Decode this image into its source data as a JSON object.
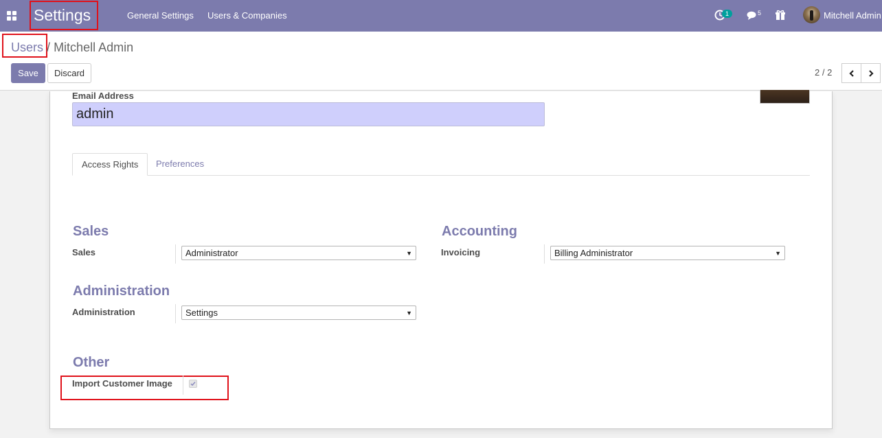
{
  "navbar": {
    "brand": "Settings",
    "menu": [
      "General Settings",
      "Users & Companies"
    ],
    "activity_count": "1",
    "messages_count": "5",
    "user_name": "Mitchell Admin"
  },
  "breadcrumb": {
    "parent": "Users",
    "separator": "/",
    "current": "Mitchell Admin"
  },
  "buttons": {
    "save": "Save",
    "discard": "Discard"
  },
  "pager": {
    "value": "2 / 2"
  },
  "form": {
    "email_label": "Email Address",
    "email_value": "admin",
    "tabs": [
      "Access Rights",
      "Preferences"
    ],
    "active_tab": "Access Rights",
    "sales": {
      "title": "Sales",
      "field_label": "Sales",
      "value": "Administrator"
    },
    "accounting": {
      "title": "Accounting",
      "field_label": "Invoicing",
      "value": "Billing Administrator"
    },
    "administration": {
      "title": "Administration",
      "field_label": "Administration",
      "value": "Settings"
    },
    "other": {
      "title": "Other",
      "field_label": "Import Customer Image",
      "checked": true
    }
  },
  "colors": {
    "brand": "#7c7bad",
    "highlight": "#e0111a",
    "email_bg": "#cfcffc"
  }
}
